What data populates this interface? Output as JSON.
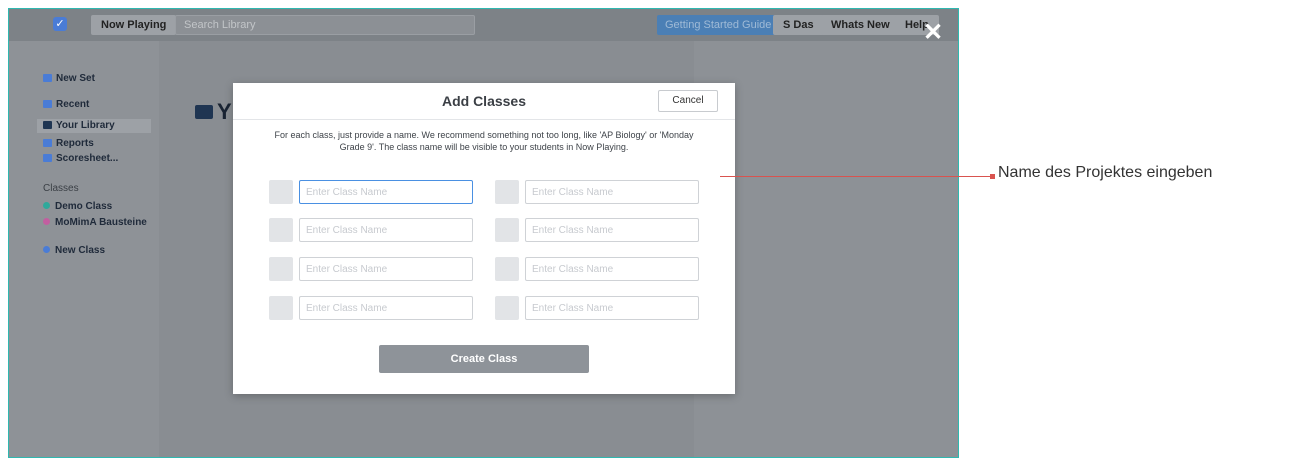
{
  "topbar": {
    "now_playing": "Now Playing",
    "search_placeholder": "Search Library",
    "getting_started": "Getting Started Guide",
    "user": "S Das",
    "whats_new": "Whats New",
    "help": "Help"
  },
  "sidebar": {
    "new_set": "New Set",
    "recent": "Recent",
    "your_library": "Your Library",
    "reports": "Reports",
    "scoresheet": "Scoresheet...",
    "classes_header": "Classes",
    "classes": [
      {
        "name": "Demo Class",
        "color": "#2fa99b"
      },
      {
        "name": "MoMimA Bausteine",
        "color": "#c25ea0"
      }
    ],
    "new_class": "New Class"
  },
  "main": {
    "title_partial": "Y"
  },
  "modal": {
    "title": "Add Classes",
    "cancel": "Cancel",
    "instructions": "For each class, just provide a name. We recommend something not too long, like 'AP Biology' or 'Monday Grade 9'. The class name will be visible to your students in Now Playing.",
    "input_placeholder": "Enter Class Name",
    "create": "Create Class"
  },
  "annotation": {
    "text": "Name des Projektes eingeben",
    "color": "#d9534f"
  },
  "colors": {
    "accent": "#2fb8b0",
    "primary": "#4a90e2"
  }
}
